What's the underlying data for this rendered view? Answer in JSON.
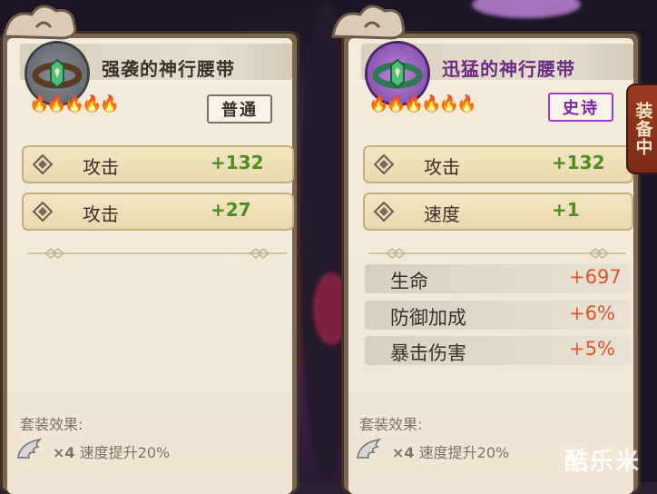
{
  "cards": [
    {
      "title": "强袭的神行腰带",
      "rarity": "普通",
      "main_stats": [
        {
          "label": "攻击",
          "value": "+132"
        },
        {
          "label": "攻击",
          "value": "+27"
        }
      ],
      "sub_stats": [],
      "set_title": "套装效果:",
      "set_count": "×4",
      "set_effect": "速度提升20%"
    },
    {
      "title": "迅猛的神行腰带",
      "rarity": "史诗",
      "main_stats": [
        {
          "label": "攻击",
          "value": "+132"
        },
        {
          "label": "速度",
          "value": "+1"
        }
      ],
      "sub_stats": [
        {
          "label": "生命",
          "value": "+697"
        },
        {
          "label": "防御加成",
          "value": "+6%"
        },
        {
          "label": "暴击伤害",
          "value": "+5%"
        }
      ],
      "set_title": "套装效果:",
      "set_count": "×4",
      "set_effect": "速度提升20%"
    }
  ],
  "equipped_tab": "装备中",
  "watermark": "酷乐米",
  "icons": [
    "belt-icon",
    "flame-icon",
    "diamond-icon",
    "wing-icon",
    "cloud-ornament"
  ],
  "colors": {
    "stat_value": "#4d8e20",
    "sub_value": "#e0552b",
    "epic": "#7b2aa3"
  }
}
